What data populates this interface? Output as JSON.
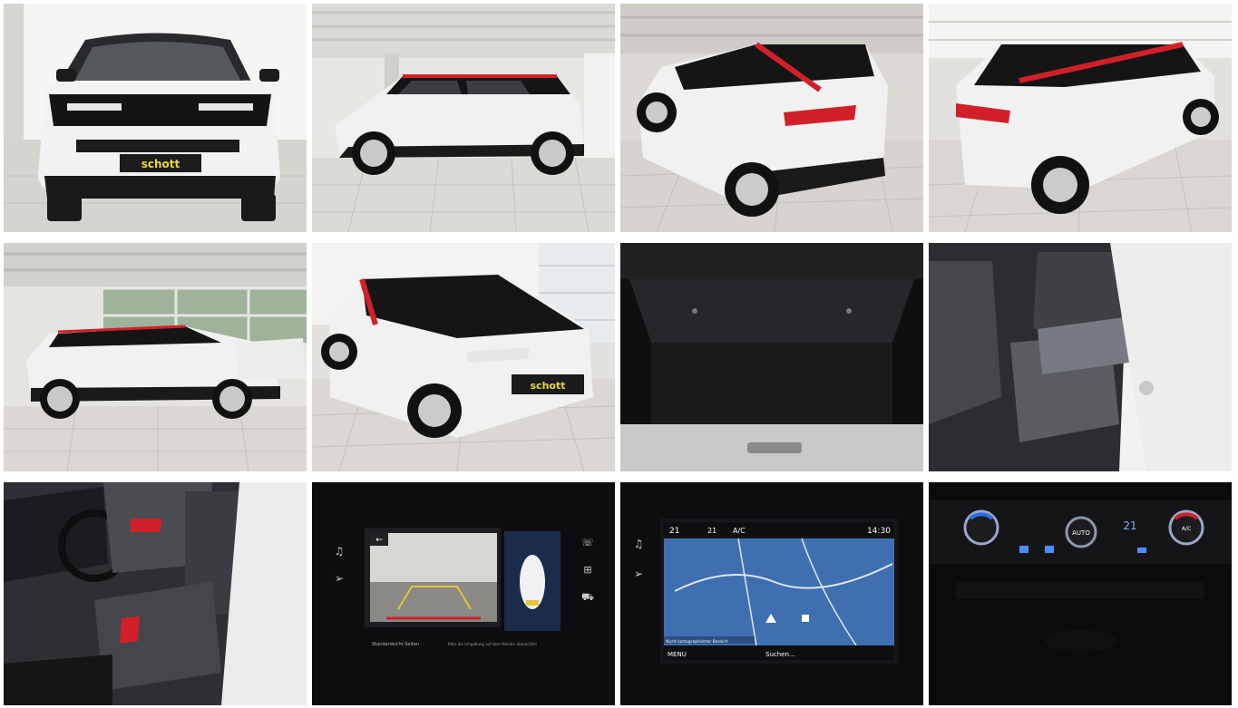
{
  "gallery": {
    "dealer_badge": "schott",
    "screen_nav": {
      "temp_left": "21",
      "fan": "21",
      "ac": "A/C",
      "time": "14:30",
      "menu": "MENU",
      "search": "Suchen...",
      "status": "Nicht kartographierter Bereich"
    },
    "screen_cam": {
      "standard": "Standardsicht Seiten",
      "hint": "Bitte die Umgebung auf dem Monitor überprüfen"
    },
    "climate": {
      "temp_right": "21",
      "auto": "AUTO",
      "ac": "A/C"
    }
  },
  "colors": {
    "body_white": "#f4f4f4",
    "roof_black": "#111111",
    "accent_red": "#d2202a",
    "floor": "#d8d6d0"
  }
}
